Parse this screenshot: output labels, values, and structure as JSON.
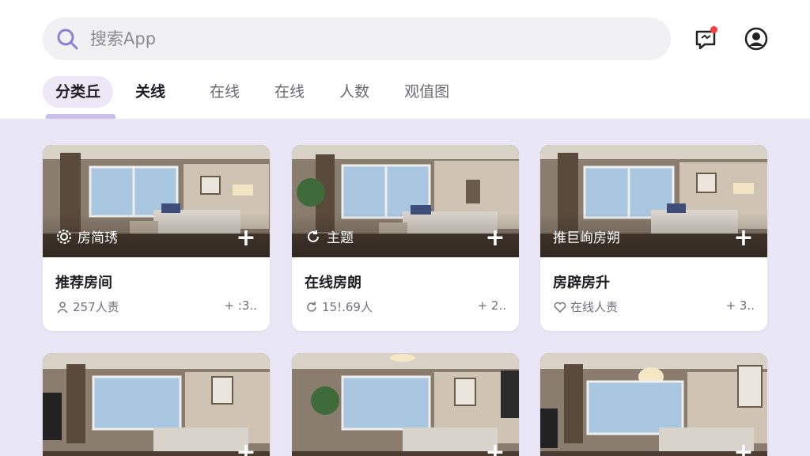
{
  "search": {
    "placeholder": "搜索App"
  },
  "header_icons": [
    "chat-notification-icon",
    "profile-icon"
  ],
  "tabs": [
    {
      "label": "分类丘",
      "active": true
    },
    {
      "label": "关线"
    },
    {
      "label": "在线"
    },
    {
      "label": "在线"
    },
    {
      "label": "人数"
    },
    {
      "label": "观值图"
    }
  ],
  "cards": [
    {
      "badge": "房简琇",
      "badge_icon": "gear-icon",
      "title": "推荐房间",
      "meta": "257人责",
      "meta_icon": "person-icon",
      "right": "+ :3.."
    },
    {
      "badge": "主题",
      "badge_icon": "refresh-icon",
      "title": "在线房朗",
      "meta": "15!.69人",
      "meta_icon": "refresh-icon",
      "right": "+ 2.."
    },
    {
      "badge": "推巨峋房朔",
      "badge_icon": "",
      "title": "房辟房升",
      "meta": "在线人责",
      "meta_icon": "heart-icon",
      "right": "+ 3.."
    }
  ],
  "colors": {
    "accent": "#cbbff0",
    "background": "#e9e6f6",
    "notification": "#ff3b3b"
  }
}
